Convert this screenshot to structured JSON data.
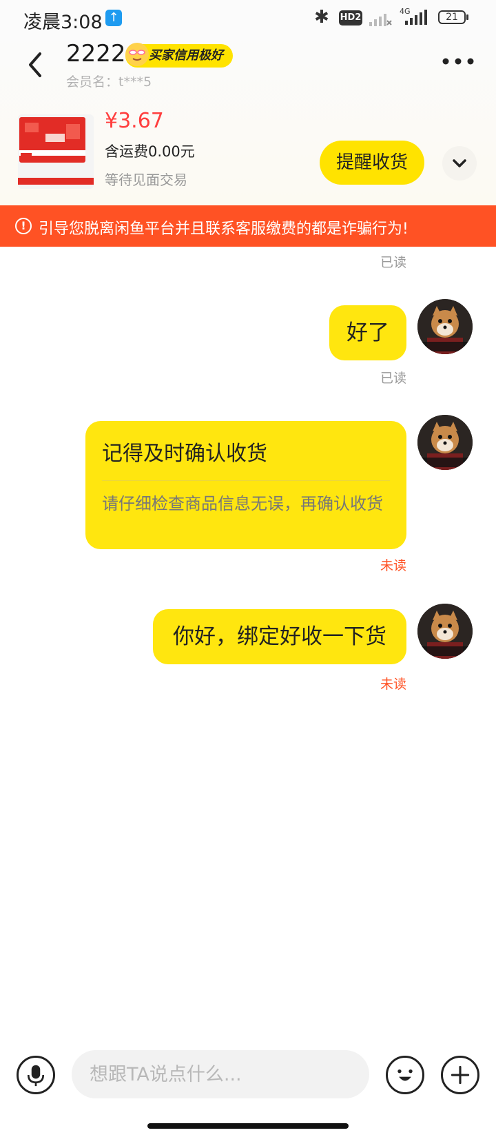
{
  "status_bar": {
    "time": "凌晨3:08",
    "upload_icon": "arrow-up-icon",
    "hd_label": "HD2",
    "network_label": "4G",
    "battery": "21"
  },
  "header": {
    "title": "2222",
    "credit_badge": "买家信用极好",
    "member_name": "会员名：t***5",
    "back_icon": "chevron-left-icon",
    "more_icon": "more-icon"
  },
  "product": {
    "price": "¥3.67",
    "shipping": "含运费0.00元",
    "status": "等待见面交易",
    "remind_button": "提醒收货",
    "expand_icon": "chevron-down-icon"
  },
  "warning": {
    "icon": "alert-icon",
    "text": "引导您脱离闲鱼平台并且联系客服缴费的都是诈骗行为!"
  },
  "messages": [
    {
      "status": "已读"
    },
    {
      "text": "好了",
      "status": "已读"
    },
    {
      "title": "记得及时确认收货",
      "desc": "请仔细检查商品信息无误，再确认收货",
      "status": "未读"
    },
    {
      "text": "你好，绑定好收一下货",
      "status": "未读"
    }
  ],
  "input_bar": {
    "placeholder": "想跟TA说点什么...",
    "mic_icon": "microphone-icon",
    "emoji_icon": "emoji-icon",
    "plus_icon": "plus-icon"
  },
  "colors": {
    "accent": "#ffe60f",
    "warning": "#ff5224",
    "price": "#ff3e3e"
  }
}
